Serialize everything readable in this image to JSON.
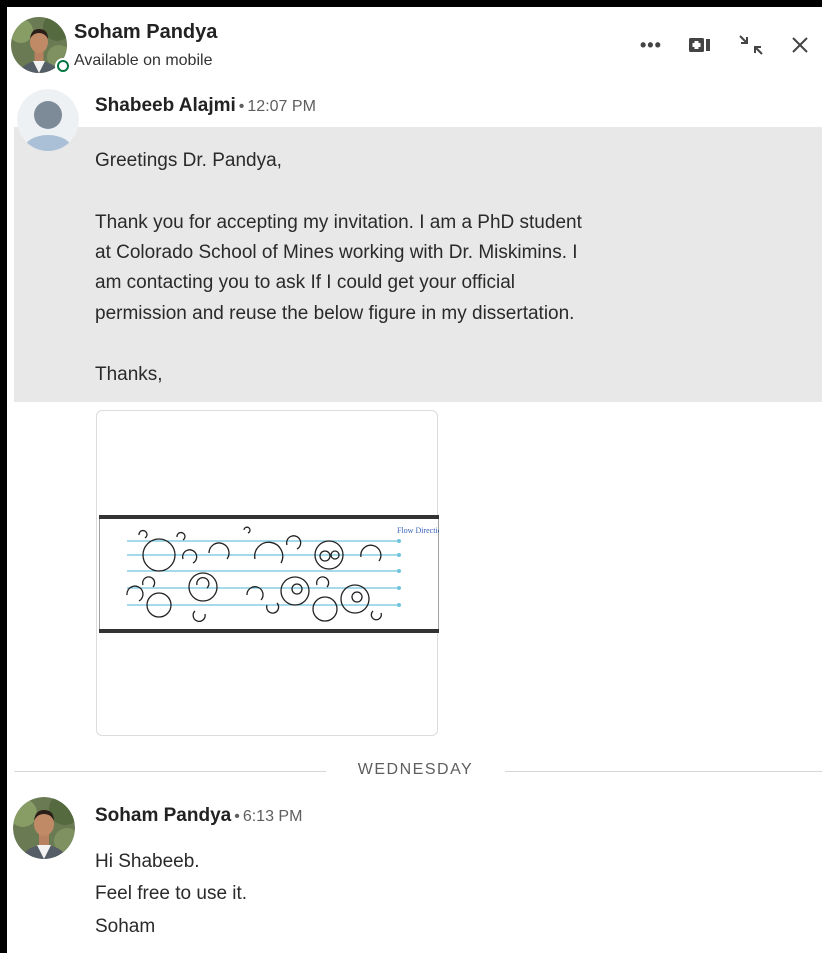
{
  "header": {
    "name": "Soham Pandya",
    "status": "Available on mobile",
    "actions": {
      "more_icon": "more-dots-icon",
      "video_icon": "video-call-icon",
      "minimize_icon": "compress-arrows-icon",
      "close_icon": "close-icon"
    },
    "more_label": "•••"
  },
  "messages": [
    {
      "sender": "Shabeeb Alajmi",
      "time": "12:07 PM",
      "lines": [
        "Greetings Dr. Pandya,",
        "Thank you for accepting my invitation. I am a PhD student",
        "at Colorado School of Mines working with Dr. Miskimins. I",
        "am contacting you to ask If I could get your official",
        "permission and reuse the below figure in my dissertation.",
        "Thanks,"
      ],
      "attachment": {
        "figure_label": "Flow Direction"
      }
    },
    {
      "sender": "Soham Pandya",
      "time": "6:13 PM",
      "lines": [
        "Hi Shabeeb.",
        "Feel free to use it.",
        "Soham"
      ]
    }
  ],
  "divider": {
    "label": "WEDNESDAY"
  },
  "colors": {
    "presence": "#057642",
    "highlight_band": "#e8e8e8",
    "flow_lines": "#6fc3df",
    "figure_label": "#3b63b8"
  }
}
